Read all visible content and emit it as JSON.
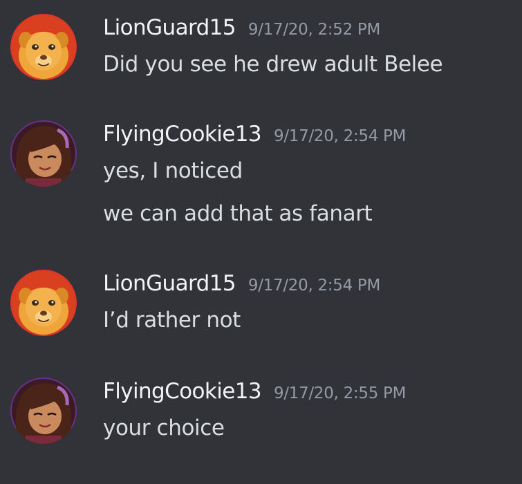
{
  "messages": [
    {
      "username": "LionGuard15",
      "timestamp": "9/17/20, 2:52 PM",
      "avatar_icon": "lion-avatar-icon",
      "lines": [
        "Did you see he drew adult Belee"
      ]
    },
    {
      "username": "FlyingCookie13",
      "timestamp": "9/17/20, 2:54 PM",
      "avatar_icon": "girl-avatar-icon",
      "lines": [
        "yes, I noticed",
        "we can add that as fanart"
      ]
    },
    {
      "username": "LionGuard15",
      "timestamp": "9/17/20, 2:54 PM",
      "avatar_icon": "lion-avatar-icon",
      "lines": [
        "I’d rather not"
      ]
    },
    {
      "username": "FlyingCookie13",
      "timestamp": "9/17/20, 2:55 PM",
      "avatar_icon": "girl-avatar-icon",
      "lines": [
        "your choice"
      ]
    }
  ],
  "colors": {
    "background": "#313338",
    "username": "#f2f3f5",
    "timestamp": "#949ba4",
    "message_text": "#dbdee1"
  }
}
